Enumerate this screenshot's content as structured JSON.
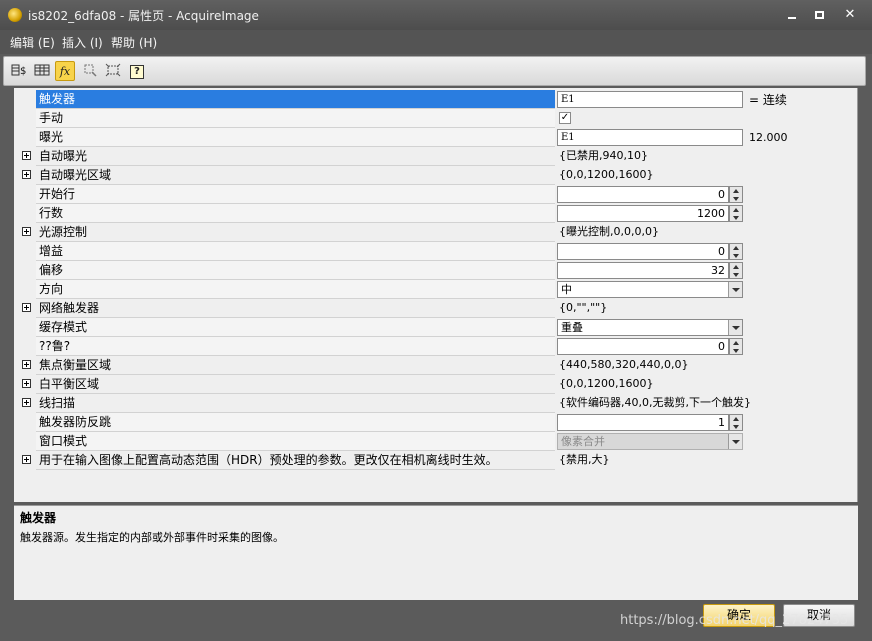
{
  "window": {
    "title": "is8202_6dfa08 - 属性页 - AcquireImage",
    "min_glyph": "",
    "close_glyph": "✕"
  },
  "menu": [
    {
      "label": "编辑 (E)"
    },
    {
      "label": "插入 (I)"
    },
    {
      "label": "帮助 (H)"
    }
  ],
  "toolbar": {
    "icons": [
      "table-dollar-icon",
      "grid-icon",
      "function-icon",
      "zoom-icon",
      "fit-icon",
      "help-icon"
    ],
    "fx_label": "fx",
    "help_label": "?"
  },
  "properties": [
    {
      "name": "触发器",
      "value": "E1",
      "extra": "= 连续",
      "selected": true
    },
    {
      "name": "手动",
      "value": "✓"
    },
    {
      "name": "曝光",
      "value": "E1",
      "extra": "12.000"
    },
    {
      "name": "自动曝光",
      "value": "{已禁用,940,10}",
      "expandable": true
    },
    {
      "name": "自动曝光区域",
      "value": "{0,0,1200,1600}",
      "expandable": true
    },
    {
      "name": "开始行",
      "value": "0"
    },
    {
      "name": "行数",
      "value": "1200"
    },
    {
      "name": "光源控制",
      "value": "{曝光控制,0,0,0,0}",
      "expandable": true
    },
    {
      "name": "增益",
      "value": "0"
    },
    {
      "name": "偏移",
      "value": "32"
    },
    {
      "name": "方向",
      "value": "中"
    },
    {
      "name": "网络触发器",
      "value": "{0,\"\",\"\"}",
      "expandable": true
    },
    {
      "name": "缓存模式",
      "value": "重叠"
    },
    {
      "name": "??鲁?",
      "value": "0"
    },
    {
      "name": "焦点衡量区域",
      "value": "{440,580,320,440,0,0}",
      "expandable": true
    },
    {
      "name": "白平衡区域",
      "value": "{0,0,1200,1600}",
      "expandable": true
    },
    {
      "name": "线扫描",
      "value": "{软件编码器,40,0,无裁剪,下一个触发}",
      "expandable": true
    },
    {
      "name": "触发器防反跳",
      "value": "1"
    },
    {
      "name": "窗口模式",
      "value": "像素合并"
    },
    {
      "name": "用于在输入图像上配置高动态范围（HDR）预处理的参数。更改仅在相机离线时生效。",
      "value": "{禁用,大}",
      "expandable": true
    }
  ],
  "description": {
    "title": "触发器",
    "text": "触发器源。发生指定的内部或外部事件时采集的图像。"
  },
  "buttons": {
    "ok": "确定",
    "cancel": "取消"
  },
  "watermark": "https://blog.csdn.net/qq_27824735"
}
